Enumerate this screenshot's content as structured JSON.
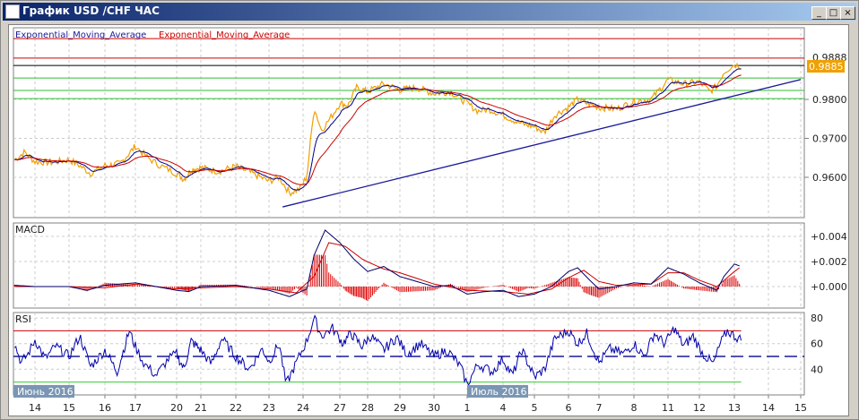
{
  "window": {
    "title": "График USD /CHF  ЧАС",
    "min": "_",
    "max": "□",
    "close": "×"
  },
  "legend": {
    "ema1": "Exponential_Moving_Average",
    "ema2": "Exponential_Moving_Average"
  },
  "price_panel": {
    "current_price": "0.9885",
    "hidden_label": "0.9888",
    "ticks": [
      "0.9800",
      "0.9700",
      "0.9600"
    ],
    "tick_values": [
      0.98,
      0.97,
      0.96
    ],
    "hlines": [
      {
        "value": 0.9956,
        "color": "#cc0000"
      },
      {
        "value": 0.9906,
        "color": "#cc0000"
      },
      {
        "value": 0.9887,
        "color": "#000000"
      },
      {
        "value": 0.9855,
        "color": "#33bb33"
      },
      {
        "value": 0.9823,
        "color": "#33bb33"
      },
      {
        "value": 0.9802,
        "color": "#33bb33"
      }
    ],
    "trendline": [
      [
        7.4,
        0.9524
      ],
      [
        23.1,
        0.9851
      ]
    ]
  },
  "macd_panel": {
    "label": "MACD",
    "ticks": [
      "+0.004",
      "+0.002",
      "+0.000"
    ],
    "tick_values": [
      0.004,
      0.002,
      0.0
    ]
  },
  "rsi_panel": {
    "label": "RSI",
    "ticks": [
      "80",
      "60",
      "40"
    ],
    "tick_values": [
      80,
      60,
      40
    ],
    "levels": {
      "high": 70,
      "mid": 50,
      "low": 30
    }
  },
  "x_axis": {
    "days": [
      "14",
      "15",
      "16",
      "17",
      "20",
      "21",
      "22",
      "23",
      "24",
      "27",
      "28",
      "29",
      "30",
      "1",
      "4",
      "5",
      "6",
      "7",
      "8",
      "11",
      "12",
      "13",
      "14",
      "15"
    ],
    "month_labels": [
      {
        "text": "Июнь 2016",
        "index": -0.6
      },
      {
        "text": "Июль 2016",
        "index": 13
      }
    ]
  },
  "colors": {
    "price": "#f0a000",
    "ema_fast": "#00008b",
    "ema_slow": "#cc0000",
    "macd_hist": "#dd0000",
    "rsi": "#0000aa"
  },
  "chart_data": {
    "type": "line",
    "title": "График USD /CHF  ЧАС",
    "price": [
      [
        -0.6,
        0.9645
      ],
      [
        -0.3,
        0.9665
      ],
      [
        0,
        0.964
      ],
      [
        0.5,
        0.9638
      ],
      [
        1,
        0.9645
      ],
      [
        1.3,
        0.963
      ],
      [
        1.6,
        0.961
      ],
      [
        2,
        0.963
      ],
      [
        2.5,
        0.9635
      ],
      [
        3,
        0.968
      ],
      [
        3.3,
        0.965
      ],
      [
        3.6,
        0.963
      ],
      [
        4,
        0.961
      ],
      [
        4.3,
        0.9595
      ],
      [
        4.6,
        0.962
      ],
      [
        5,
        0.9625
      ],
      [
        5.5,
        0.9615
      ],
      [
        6,
        0.9628
      ],
      [
        6.5,
        0.961
      ],
      [
        7,
        0.959
      ],
      [
        7.3,
        0.96
      ],
      [
        7.6,
        0.956
      ],
      [
        7.9,
        0.957
      ],
      [
        8.1,
        0.96
      ],
      [
        8.3,
        0.978
      ],
      [
        8.5,
        0.972
      ],
      [
        8.8,
        0.976
      ],
      [
        9,
        0.979
      ],
      [
        9.3,
        0.9785
      ],
      [
        9.6,
        0.983
      ],
      [
        10,
        0.982
      ],
      [
        10.5,
        0.984
      ],
      [
        11,
        0.9825
      ],
      [
        11.5,
        0.983
      ],
      [
        12,
        0.9815
      ],
      [
        12.5,
        0.982
      ],
      [
        13,
        0.979
      ],
      [
        13.3,
        0.977
      ],
      [
        13.6,
        0.9775
      ],
      [
        14,
        0.976
      ],
      [
        14.5,
        0.974
      ],
      [
        15,
        0.973
      ],
      [
        15.3,
        0.9715
      ],
      [
        15.6,
        0.976
      ],
      [
        16,
        0.978
      ],
      [
        16.3,
        0.98
      ],
      [
        16.6,
        0.979
      ],
      [
        17,
        0.978
      ],
      [
        17.5,
        0.9775
      ],
      [
        18,
        0.9795
      ],
      [
        18.5,
        0.98
      ],
      [
        18.8,
        0.983
      ],
      [
        19,
        0.985
      ],
      [
        19.5,
        0.984
      ],
      [
        20,
        0.9845
      ],
      [
        20.3,
        0.982
      ],
      [
        20.5,
        0.9835
      ],
      [
        20.7,
        0.987
      ],
      [
        21,
        0.989
      ],
      [
        21.2,
        0.9885
      ]
    ],
    "macd": [
      [
        -0.6,
        0.0001
      ],
      [
        0,
        0.0
      ],
      [
        1,
        0.0
      ],
      [
        1.5,
        -0.0003
      ],
      [
        2,
        0.0001
      ],
      [
        3,
        0.0003
      ],
      [
        4,
        -0.0003
      ],
      [
        4.5,
        -0.0004
      ],
      [
        5,
        0.0
      ],
      [
        6,
        0.0001
      ],
      [
        7,
        -0.0003
      ],
      [
        7.6,
        -0.0008
      ],
      [
        8.1,
        -0.0002
      ],
      [
        8.3,
        0.0025
      ],
      [
        8.6,
        0.0045
      ],
      [
        9,
        0.0035
      ],
      [
        9.5,
        0.0022
      ],
      [
        10,
        0.0012
      ],
      [
        10.5,
        0.0016
      ],
      [
        11,
        0.0008
      ],
      [
        12,
        0.0
      ],
      [
        12.5,
        0.0001
      ],
      [
        13,
        -0.0006
      ],
      [
        13.5,
        -0.0004
      ],
      [
        14,
        -0.0003
      ],
      [
        14.5,
        -0.0008
      ],
      [
        15,
        -0.0006
      ],
      [
        15.5,
        0.0
      ],
      [
        16,
        0.0012
      ],
      [
        16.3,
        0.0015
      ],
      [
        16.7,
        0.0005
      ],
      [
        17,
        -0.0002
      ],
      [
        17.5,
        0.0
      ],
      [
        18,
        0.0003
      ],
      [
        18.5,
        0.0002
      ],
      [
        19,
        0.0015
      ],
      [
        19.5,
        0.001
      ],
      [
        20,
        0.0003
      ],
      [
        20.5,
        -0.0003
      ],
      [
        20.7,
        0.0008
      ],
      [
        21,
        0.0018
      ],
      [
        21.2,
        0.0016
      ]
    ],
    "signal": [
      [
        -0.6,
        0.0
      ],
      [
        0,
        0.0
      ],
      [
        1,
        0.0
      ],
      [
        2,
        -0.0001
      ],
      [
        3,
        0.0002
      ],
      [
        4,
        -0.0002
      ],
      [
        5,
        -0.0001
      ],
      [
        6,
        0.0
      ],
      [
        7,
        -0.0002
      ],
      [
        7.8,
        -0.0005
      ],
      [
        8.3,
        0.0008
      ],
      [
        8.7,
        0.0035
      ],
      [
        9.2,
        0.0032
      ],
      [
        9.8,
        0.0022
      ],
      [
        10.5,
        0.0014
      ],
      [
        11,
        0.0011
      ],
      [
        12,
        0.0002
      ],
      [
        13,
        -0.0003
      ],
      [
        14,
        -0.0004
      ],
      [
        14.8,
        -0.0006
      ],
      [
        15.5,
        -0.0002
      ],
      [
        16,
        0.0007
      ],
      [
        16.5,
        0.0013
      ],
      [
        17,
        0.0004
      ],
      [
        17.5,
        0.0001
      ],
      [
        18.5,
        0.0002
      ],
      [
        19,
        0.0011
      ],
      [
        19.5,
        0.0011
      ],
      [
        20,
        0.0005
      ],
      [
        20.5,
        0.0
      ],
      [
        21,
        0.0012
      ],
      [
        21.2,
        0.0016
      ]
    ],
    "rsi": [
      [
        -0.6,
        60
      ],
      [
        -0.4,
        45
      ],
      [
        -0.2,
        52
      ],
      [
        0,
        63
      ],
      [
        0.3,
        48
      ],
      [
        0.6,
        58
      ],
      [
        1,
        50
      ],
      [
        1.3,
        66
      ],
      [
        1.6,
        42
      ],
      [
        2,
        55
      ],
      [
        2.4,
        38
      ],
      [
        2.8,
        70
      ],
      [
        3.2,
        45
      ],
      [
        3.5,
        35
      ],
      [
        3.8,
        48
      ],
      [
        4,
        52
      ],
      [
        4.3,
        40
      ],
      [
        4.6,
        62
      ],
      [
        5,
        55
      ],
      [
        5.3,
        44
      ],
      [
        5.6,
        64
      ],
      [
        6,
        50
      ],
      [
        6.4,
        40
      ],
      [
        6.8,
        56
      ],
      [
        7,
        46
      ],
      [
        7.3,
        60
      ],
      [
        7.5,
        28
      ],
      [
        7.8,
        45
      ],
      [
        8.1,
        62
      ],
      [
        8.3,
        80
      ],
      [
        8.5,
        66
      ],
      [
        8.8,
        72
      ],
      [
        9.1,
        60
      ],
      [
        9.4,
        68
      ],
      [
        9.8,
        58
      ],
      [
        10.1,
        66
      ],
      [
        10.5,
        55
      ],
      [
        10.9,
        65
      ],
      [
        11.2,
        52
      ],
      [
        11.6,
        60
      ],
      [
        12,
        50
      ],
      [
        12.4,
        55
      ],
      [
        12.8,
        42
      ],
      [
        13,
        28
      ],
      [
        13.3,
        44
      ],
      [
        13.7,
        38
      ],
      [
        14,
        48
      ],
      [
        14.3,
        35
      ],
      [
        14.6,
        55
      ],
      [
        15,
        34
      ],
      [
        15.3,
        40
      ],
      [
        15.6,
        64
      ],
      [
        16,
        70
      ],
      [
        16.3,
        60
      ],
      [
        16.6,
        68
      ],
      [
        17,
        45
      ],
      [
        17.3,
        56
      ],
      [
        17.7,
        52
      ],
      [
        18,
        60
      ],
      [
        18.3,
        50
      ],
      [
        18.6,
        68
      ],
      [
        18.9,
        60
      ],
      [
        19.2,
        72
      ],
      [
        19.5,
        58
      ],
      [
        19.8,
        66
      ],
      [
        20.1,
        52
      ],
      [
        20.4,
        44
      ],
      [
        20.6,
        60
      ],
      [
        20.8,
        70
      ],
      [
        21,
        66
      ],
      [
        21.2,
        63
      ]
    ]
  }
}
